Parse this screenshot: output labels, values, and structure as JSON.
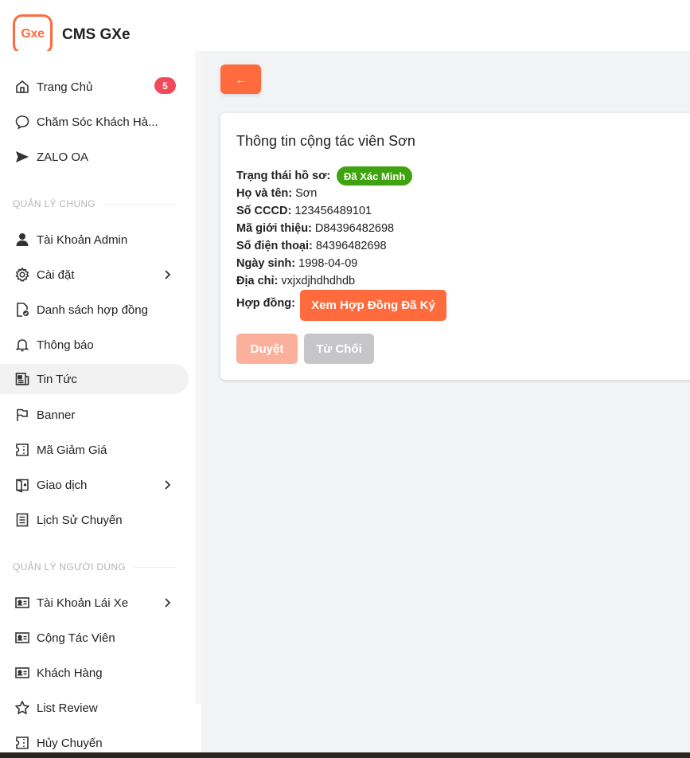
{
  "app": {
    "logo_text": "Gxe",
    "title": "CMS GXe",
    "accent": "#ff6b3d"
  },
  "sidebar": {
    "items_top": [
      {
        "label": "Trang Chủ",
        "icon": "home-icon",
        "badge": "5"
      },
      {
        "label": "Chăm Sóc Khách Hà...",
        "icon": "chat-bubble-icon"
      },
      {
        "label": "ZALO OA",
        "icon": "send-icon"
      }
    ],
    "section_general": "QUẢN LÝ CHUNG",
    "items_general": [
      {
        "label": "Tài Khoản Admin",
        "icon": "user-icon"
      },
      {
        "label": "Cài đặt",
        "icon": "gear-icon",
        "expandable": true
      },
      {
        "label": "Danh sách hợp đồng",
        "icon": "contract-check-icon"
      },
      {
        "label": "Thông báo",
        "icon": "bell-icon"
      },
      {
        "label": "Tin Tức",
        "icon": "news-icon",
        "active": true
      },
      {
        "label": "Banner",
        "icon": "flag-icon"
      },
      {
        "label": "Mã Giảm Giá",
        "icon": "coupon-icon"
      },
      {
        "label": "Giao dịch",
        "icon": "transaction-icon",
        "expandable": true
      },
      {
        "label": "Lịch Sử Chuyến",
        "icon": "list-icon"
      }
    ],
    "section_users": "QUẢN LÝ NGƯỜI DÙNG",
    "items_users": [
      {
        "label": "Tài Khoản Lái Xe",
        "icon": "id-card-icon",
        "expandable": true
      },
      {
        "label": "Cộng Tác Viên",
        "icon": "id-card-icon"
      },
      {
        "label": "Khách Hàng",
        "icon": "id-card-icon"
      },
      {
        "label": "List Review",
        "icon": "star-icon"
      },
      {
        "label": "Hủy Chuyến",
        "icon": "coupon-icon"
      }
    ]
  },
  "back_button": {
    "icon": "arrow-left-icon",
    "label": "←"
  },
  "card": {
    "title": "Thông tin cộng tác viên Sơn",
    "status_label": "Trạng thái hồ sơ:",
    "status_value": "Đã Xác Minh",
    "status_color": "#3fa30e",
    "fields": [
      {
        "label": "Họ và tên:",
        "value": "Sơn"
      },
      {
        "label": "Số CCCD:",
        "value": "123456489101"
      },
      {
        "label": "Mã giới thiệu:",
        "value": "D84396482698"
      },
      {
        "label": "Số điện thoại:",
        "value": "84396482698"
      },
      {
        "label": "Ngày sinh:",
        "value": "1998-04-09"
      },
      {
        "label": "Địa chỉ:",
        "value": "vxjxdjhdhdhdb"
      }
    ],
    "contract_label": "Hợp đồng:",
    "contract_button": "Xem Hợp Đồng Đã Ký",
    "approve_button": "Duyệt",
    "reject_button": "Từ Chối"
  }
}
